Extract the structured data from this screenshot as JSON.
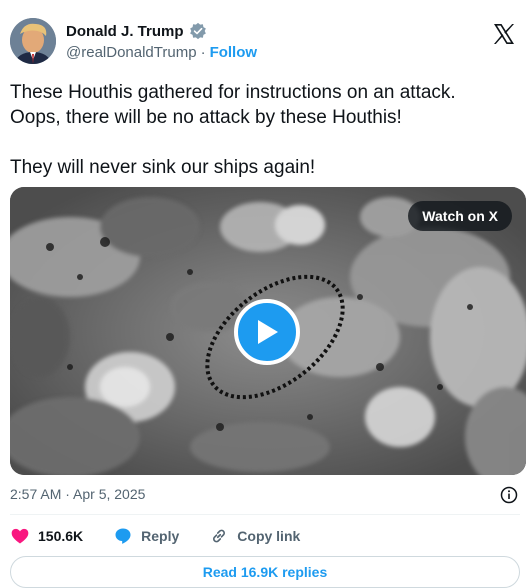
{
  "author": {
    "display_name": "Donald J. Trump",
    "handle": "@realDonaldTrump",
    "separator": "·",
    "follow_label": "Follow"
  },
  "tweet": {
    "text": "These Houthis gathered for instructions on an attack.\nOops, there will be no attack by these Houthis!\n\nThey will never sink our ships again!"
  },
  "media": {
    "watch_label": "Watch on X"
  },
  "timestamp": "2:57 AM · Apr 5, 2025",
  "actions": {
    "like_count": "150.6K",
    "reply_label": "Reply",
    "copy_link_label": "Copy link"
  },
  "read_replies_label": "Read 16.9K replies",
  "colors": {
    "accent": "#1d9bf0",
    "like": "#f91880",
    "verified": "#829aab"
  }
}
